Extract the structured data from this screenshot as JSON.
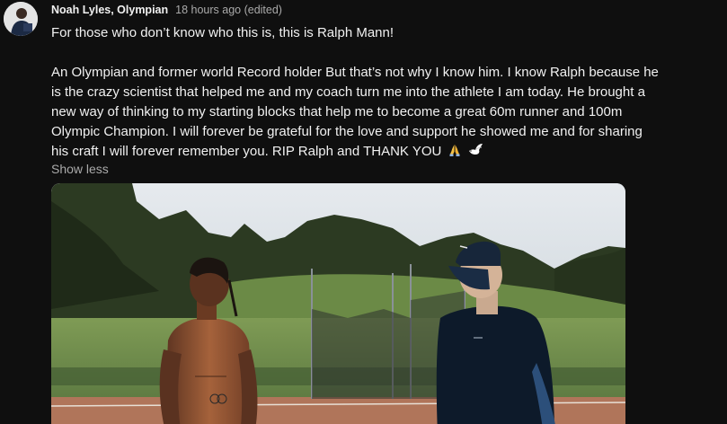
{
  "post": {
    "author": "Noah Lyles, Olympian",
    "timestamp": "18 hours ago (edited)",
    "paragraphs": [
      "For those who don’t know who this is, this is Ralph Mann!",
      "An Olympian and former world Record holder But that’s not why I know him. I know Ralph because he",
      "is the crazy scientist that helped me and my coach turn me into the athlete I am today. He brought a",
      "new way of thinking to my starting blocks that help me to become a great 60m runner and 100m",
      "Olympic Champion. I will forever be grateful for the love and support he showed me and for sharing",
      "his craft I will forever remember you. RIP Ralph and THANK YOU"
    ],
    "emojis": [
      "praying-hands-icon",
      "dove-icon"
    ],
    "show_less_label": "Show less"
  },
  "colors": {
    "background": "#0f0f0f",
    "text_primary": "#f1f1f1",
    "text_secondary": "#aaaaaa"
  }
}
